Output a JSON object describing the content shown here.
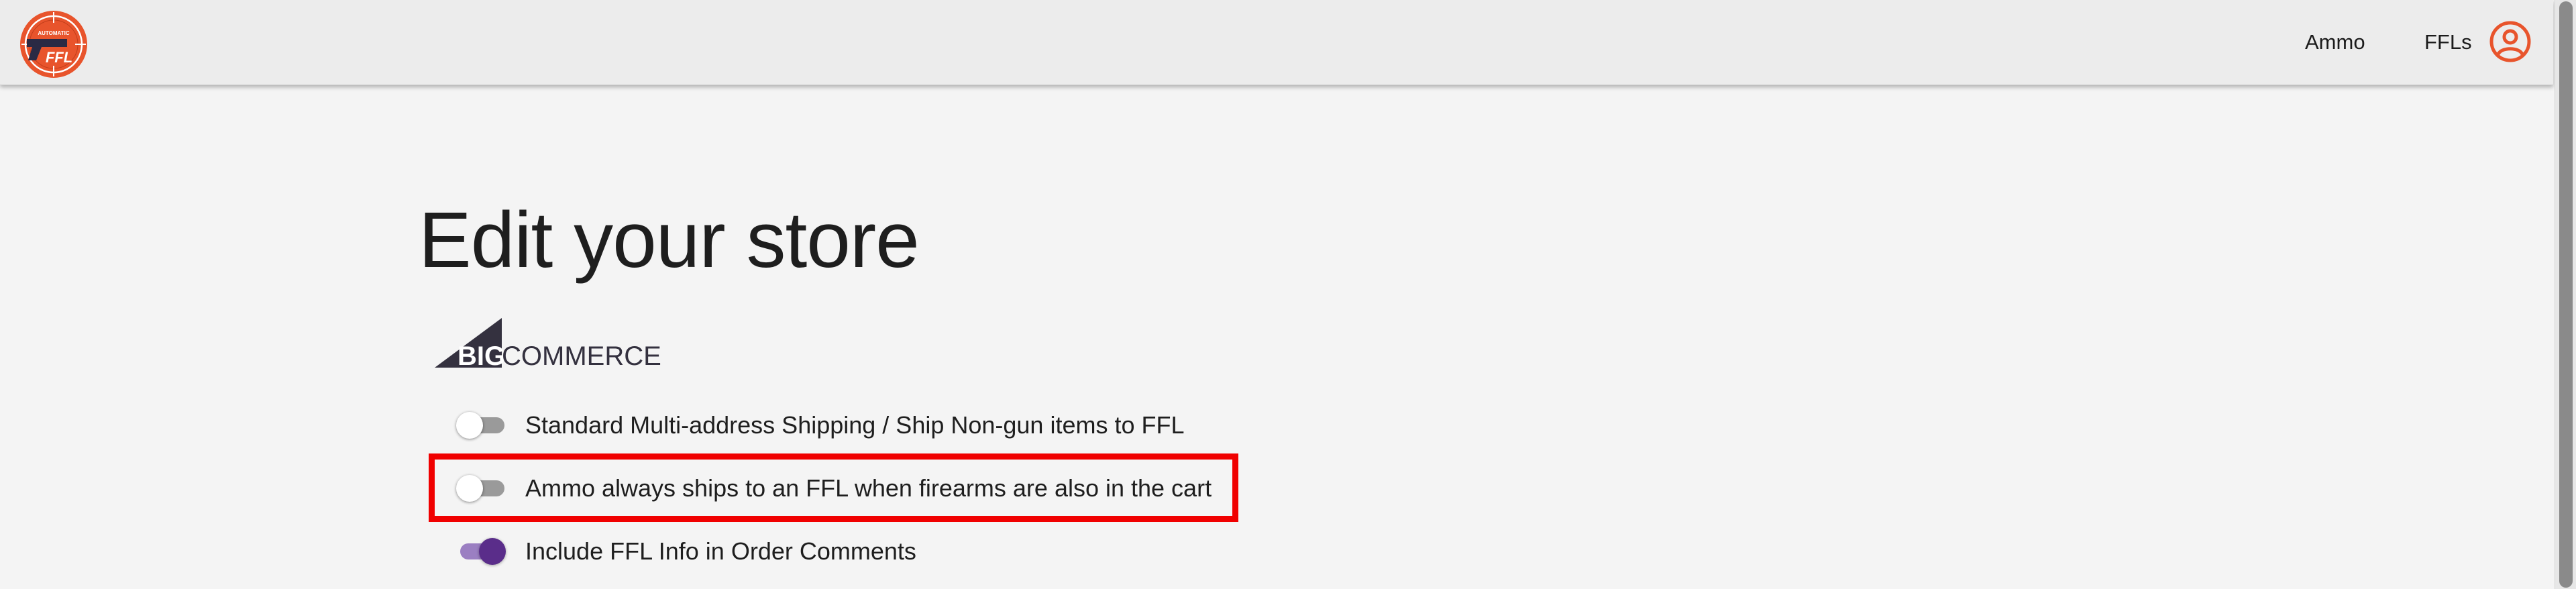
{
  "header": {
    "logo_text_top": "AUTOMATIC",
    "logo_text_main": "FFL",
    "nav": [
      {
        "label": "Ammo"
      },
      {
        "label": "FFLs"
      }
    ],
    "user_icon": "account-circle-icon"
  },
  "main": {
    "title": "Edit your store",
    "platform": {
      "prefix": "BIG",
      "suffix": "COMMERCE"
    },
    "settings": [
      {
        "label": "Standard Multi-address Shipping / Ship Non-gun items to FFL",
        "enabled": false
      },
      {
        "label": "Ammo always ships to an FFL when firearms are also in the cart",
        "enabled": false,
        "highlighted": true
      },
      {
        "label": "Include FFL Info in Order Comments",
        "enabled": true
      }
    ]
  },
  "colors": {
    "accent_orange": "#e8542c",
    "toggle_on": "#5a2d8a",
    "highlight": "#f00000",
    "background": "#f4f4f4",
    "header": "#ececec"
  }
}
